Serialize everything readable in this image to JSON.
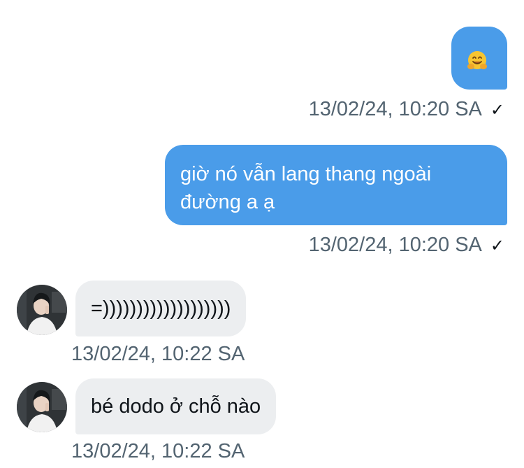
{
  "messages": [
    {
      "direction": "outgoing",
      "content_icon": "hugging-face-emoji",
      "text": "",
      "timestamp": "13/02/24, 10:20 SA",
      "status_icon": "checkmark-icon"
    },
    {
      "direction": "outgoing",
      "text": "giờ nó vẫn lang thang ngoài\nđường a ạ",
      "timestamp": "13/02/24, 10:20 SA",
      "status_icon": "checkmark-icon"
    },
    {
      "direction": "incoming",
      "text": "=)))))))))))))))))))",
      "timestamp": "13/02/24, 10:22 SA",
      "avatar_icon": "user-avatar"
    },
    {
      "direction": "incoming",
      "text": "bé dodo ở chỗ nào",
      "timestamp": "13/02/24, 10:22 SA",
      "avatar_icon": "user-avatar"
    }
  ],
  "colors": {
    "outgoing_bubble": "#4a9ce9",
    "incoming_bubble": "#eceef0",
    "timestamp_text": "#536471",
    "emoji_yellow": "#f7c531"
  }
}
